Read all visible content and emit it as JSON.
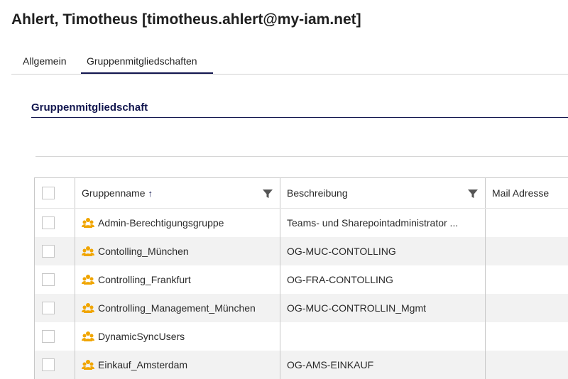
{
  "page": {
    "title": "Ahlert, Timotheus [timotheus.ahlert@my-iam.net]"
  },
  "tabs": [
    {
      "label": "Allgemein",
      "active": false
    },
    {
      "label": "Gruppenmitgliedschaften",
      "active": true
    }
  ],
  "section": {
    "title": "Gruppenmitgliedschaft"
  },
  "colors": {
    "accent": "#12164f",
    "group_icon": "#f0a500",
    "row_alt": "#f2f2f2"
  },
  "table": {
    "columns": {
      "name": "Gruppenname",
      "name_sort": "ascending",
      "description": "Beschreibung",
      "mail": "Mail Adresse"
    },
    "rows": [
      {
        "name": "Admin-Berechtigungsgruppe",
        "description": "Teams- und Sharepointadministrator ...",
        "mail": ""
      },
      {
        "name": "Contolling_München",
        "description": "OG-MUC-CONTOLLING",
        "mail": ""
      },
      {
        "name": "Controlling_Frankfurt",
        "description": "OG-FRA-CONTOLLING",
        "mail": ""
      },
      {
        "name": "Controlling_Management_München",
        "description": "OG-MUC-CONTROLLIN_Mgmt",
        "mail": ""
      },
      {
        "name": "DynamicSyncUsers",
        "description": "",
        "mail": ""
      },
      {
        "name": "Einkauf_Amsterdam",
        "description": "OG-AMS-EINKAUF",
        "mail": ""
      }
    ]
  }
}
